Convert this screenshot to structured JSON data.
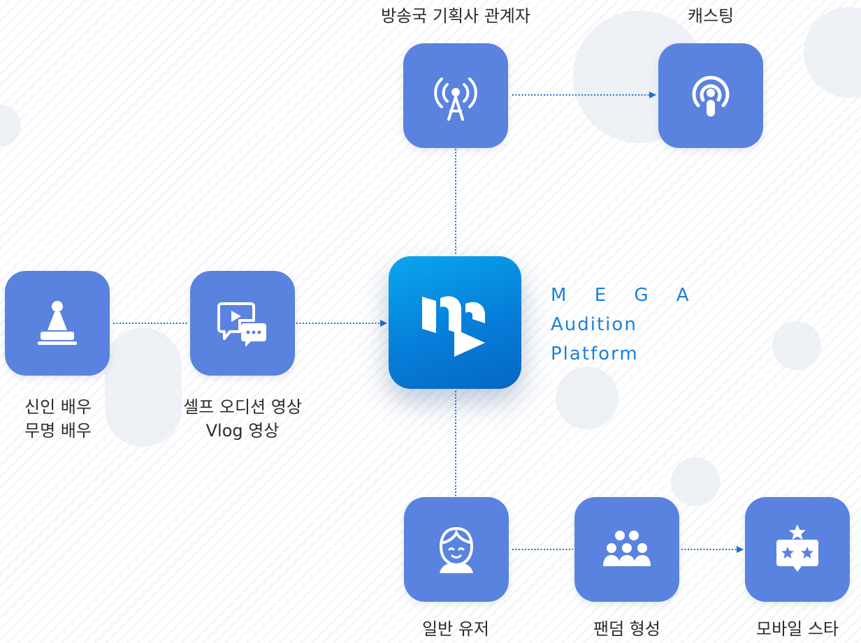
{
  "brand": {
    "line1": "M E G A",
    "line2": "Audition",
    "line3": "Platform"
  },
  "nodes": {
    "broadcaster": {
      "label": "방송국 기획사 관계자",
      "icon": "broadcast-tower-icon"
    },
    "casting": {
      "label": "캐스팅",
      "icon": "podcast-icon"
    },
    "actor": {
      "label_line1": "신인 배우",
      "label_line2": "무명 배우",
      "icon": "stamp-icon"
    },
    "video": {
      "label_line1": "셀프 오디션 영상",
      "label_line2": "Vlog 영상",
      "icon": "video-chat-icon"
    },
    "user": {
      "label": "일반 유저",
      "icon": "user-face-icon"
    },
    "fandom": {
      "label": "팬덤 형성",
      "icon": "group-icon"
    },
    "star": {
      "label": "모바일 스타",
      "icon": "star-badge-icon"
    }
  },
  "colors": {
    "node": "#5a82df",
    "connector": "#1f6fc7",
    "hub_top": "#0aa6ee",
    "hub_bottom": "#0566c4",
    "brand_text": "#1f7fd6",
    "label_text": "#2b2b2b"
  }
}
